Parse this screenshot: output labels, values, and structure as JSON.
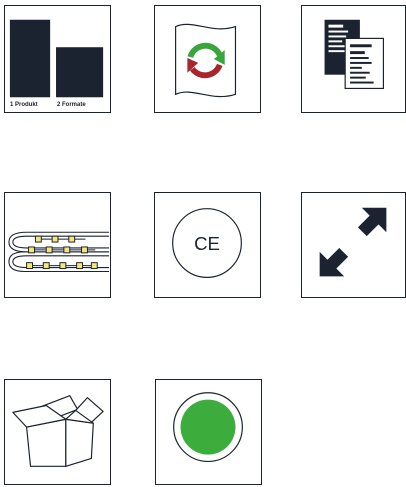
{
  "tiles": [
    {
      "icon": "two-formats-icon",
      "labels": [
        "1 Produkt",
        "2 Formate"
      ],
      "colors": {
        "dark": "#1b2230"
      }
    },
    {
      "icon": "refresh-cycle-icon",
      "colors": {
        "green": "#3aa53a",
        "red": "#a8262b"
      }
    },
    {
      "icon": "documents-icon",
      "colors": {
        "dark": "#1b2230"
      }
    },
    {
      "icon": "led-strip-icon",
      "colors": {
        "led": "#f4e77a",
        "dark": "#1b2230"
      }
    },
    {
      "icon": "ce-mark-icon",
      "text": "CE",
      "colors": {
        "dark": "#1b2230"
      }
    },
    {
      "icon": "expand-arrows-icon",
      "colors": {
        "dark": "#1b2230"
      }
    },
    {
      "icon": "open-box-icon",
      "colors": {
        "dark": "#1b2230"
      }
    },
    {
      "icon": "green-dot-icon",
      "colors": {
        "green": "#3cad3c",
        "dark": "#1b2230"
      }
    }
  ]
}
